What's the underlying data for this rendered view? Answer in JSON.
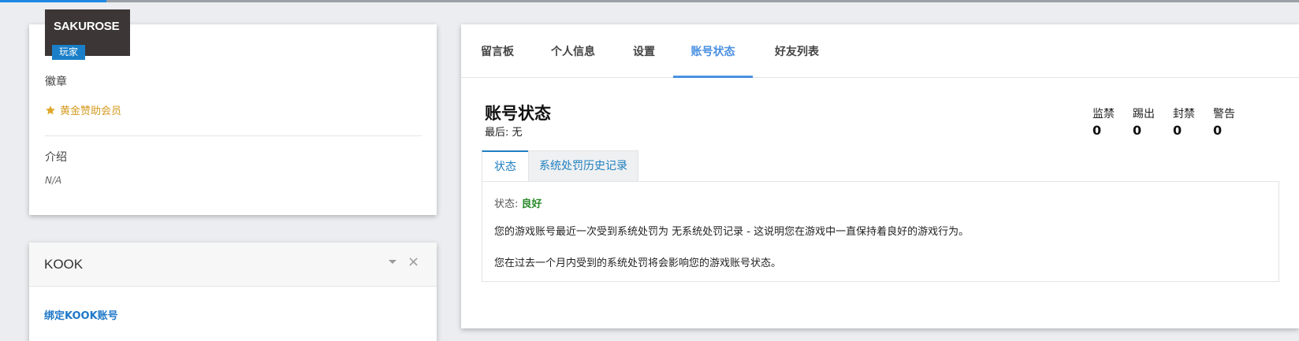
{
  "profile": {
    "username": "SAKUROSE",
    "role": "玩家",
    "badges_label": "徽章",
    "badge_item": "黄金赞助会员",
    "intro_label": "介绍",
    "intro_value": "N/A"
  },
  "kook": {
    "title": "KOOK",
    "bind_link": "绑定KOOK账号"
  },
  "tabs": [
    {
      "label": "留言板",
      "active": false
    },
    {
      "label": "个人信息",
      "active": false
    },
    {
      "label": "设置",
      "active": false
    },
    {
      "label": "账号状态",
      "active": true
    },
    {
      "label": "好友列表",
      "active": false
    }
  ],
  "account": {
    "title": "账号状态",
    "last_label": "最后: 无",
    "stats": [
      {
        "label": "监禁",
        "value": "0"
      },
      {
        "label": "踢出",
        "value": "0"
      },
      {
        "label": "封禁",
        "value": "0"
      },
      {
        "label": "警告",
        "value": "0"
      }
    ],
    "subtabs": [
      {
        "label": "状态",
        "active": true
      },
      {
        "label": "系统处罚历史记录",
        "active": false
      }
    ],
    "state_prefix": "状态:",
    "state_value": "良好",
    "paragraph1": "您的游戏账号最近一次受到系统处罚为 无系统处罚记录 - 这说明您在游戏中一直保持着良好的游戏行为。",
    "paragraph2": "您在过去一个月内受到的系统处罚将会影响您的游戏账号状态。"
  },
  "colors": {
    "accent": "#4a90e2",
    "good": "#2a8a2a",
    "badge_gold": "#d49a1f"
  }
}
